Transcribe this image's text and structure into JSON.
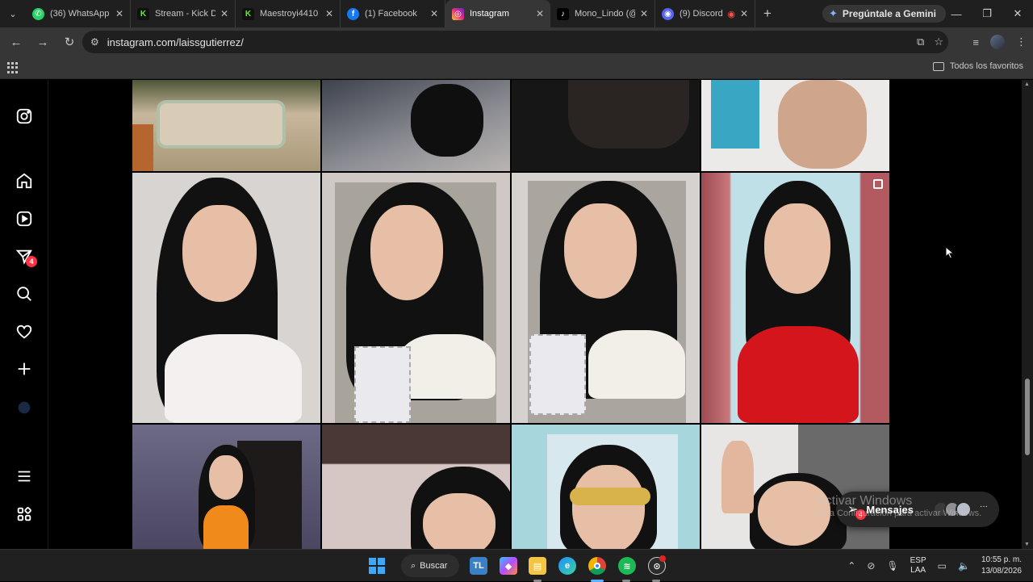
{
  "browser": {
    "tabs": [
      {
        "title": "(36) WhatsApp",
        "favicon": "whatsapp-icon",
        "color": "#25d366",
        "active": false
      },
      {
        "title": "Stream - Kick D",
        "favicon": "kick-icon",
        "color": "#53fc18",
        "active": false
      },
      {
        "title": "Maestroyi4410",
        "favicon": "kick-icon",
        "color": "#53fc18",
        "active": false
      },
      {
        "title": "(1) Facebook",
        "favicon": "facebook-icon",
        "color": "#1877f2",
        "active": false
      },
      {
        "title": "Instagram",
        "favicon": "instagram-icon",
        "color": "#e1306c",
        "active": true
      },
      {
        "title": "Mono_Lindo (@",
        "favicon": "tiktok-icon",
        "color": "#000000",
        "active": false
      },
      {
        "title": "(9) Discord",
        "favicon": "discord-icon",
        "color": "#5865f2",
        "active": false
      }
    ],
    "gemini_label": "Pregúntale a Gemini",
    "url": "instagram.com/laissgutierrez/",
    "bookmarks_all": "Todos los favoritos"
  },
  "instagram": {
    "rail": [
      {
        "name": "instagram-logo-icon"
      },
      {
        "name": "home-icon"
      },
      {
        "name": "reels-icon"
      },
      {
        "name": "messages-icon"
      },
      {
        "name": "search-icon"
      },
      {
        "name": "notifications-icon"
      },
      {
        "name": "create-icon"
      },
      {
        "name": "profile-icon"
      },
      {
        "name": "more-menu-icon"
      },
      {
        "name": "also-from-meta-icon"
      }
    ],
    "messages_badge": "4",
    "messages_pill": {
      "label": "Mensajes",
      "badge": "4",
      "more": "···"
    }
  },
  "watermark": {
    "line1": "Activar Windows",
    "line2": "Ve a Configuración para activar Windows."
  },
  "taskbar": {
    "search_label": "Buscar",
    "lang_top": "ESP",
    "lang_bottom": "LAA",
    "time": "10:55 p. m.",
    "date": "13/08/2026"
  }
}
